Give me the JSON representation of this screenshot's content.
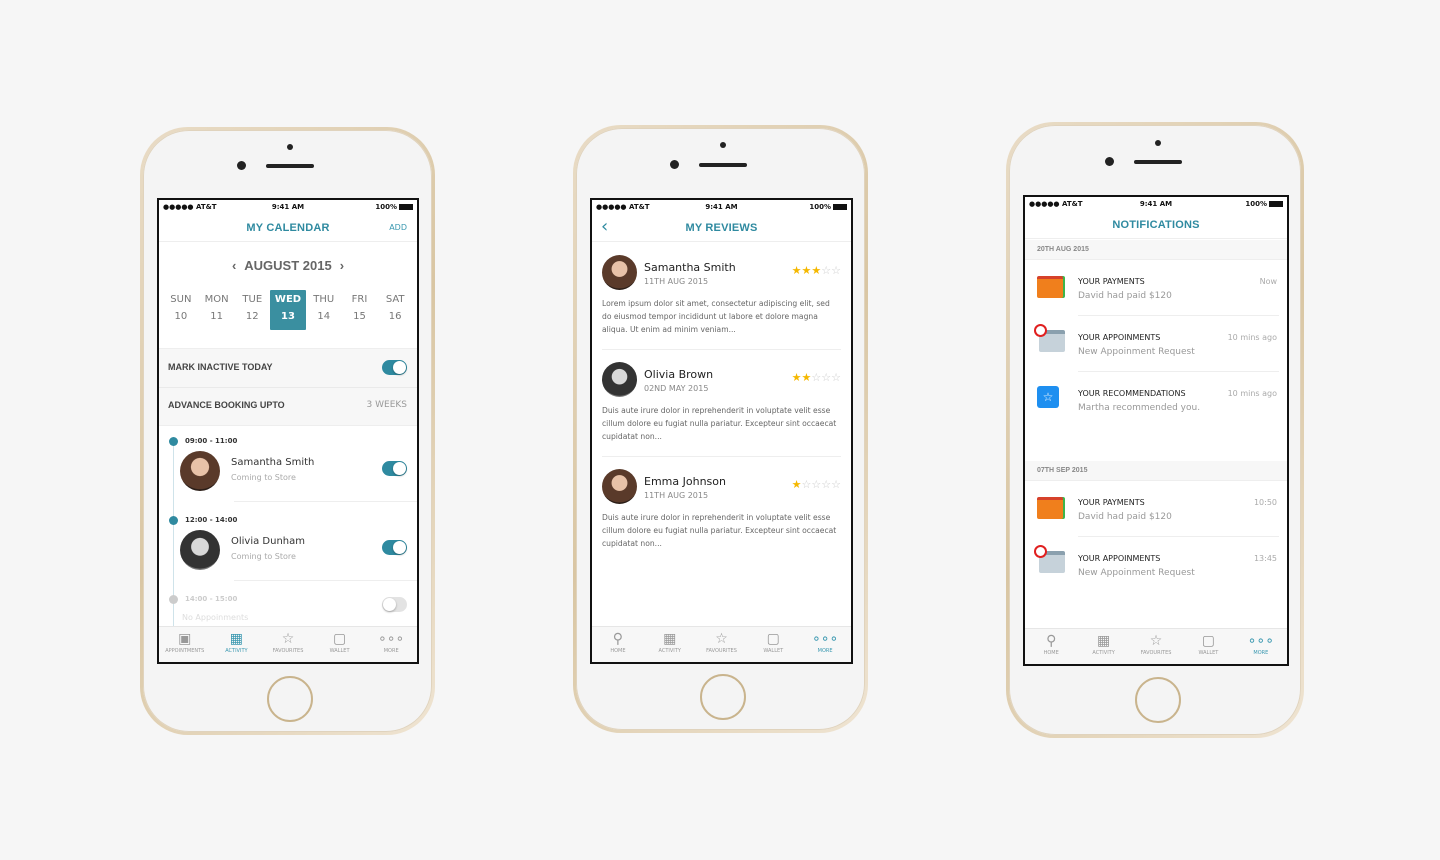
{
  "colors": {
    "accent": "#2f8aa0",
    "star": "#f5b800"
  },
  "status": {
    "carrier": "●●●●● AT&T",
    "time": "9:41 AM",
    "battery": "100%"
  },
  "calendar": {
    "title": "MY CALENDAR",
    "add": "ADD",
    "month": "AUGUST 2015",
    "days": [
      {
        "name": "SUN",
        "num": "10"
      },
      {
        "name": "MON",
        "num": "11"
      },
      {
        "name": "TUE",
        "num": "12"
      },
      {
        "name": "WED",
        "num": "13",
        "selected": true
      },
      {
        "name": "THU",
        "num": "14"
      },
      {
        "name": "FRI",
        "num": "15"
      },
      {
        "name": "SAT",
        "num": "16"
      }
    ],
    "mark_inactive": {
      "label": "MARK INACTIVE TODAY",
      "on": true
    },
    "advance": {
      "label": "ADVANCE BOOKING UPTO",
      "value": "3 WEEKS"
    },
    "slots": [
      {
        "time": "09:00 - 11:00",
        "name": "Samantha Smith",
        "sub": "Coming to Store",
        "on": true
      },
      {
        "time": "12:00 - 14:00",
        "name": "Olivia Dunham",
        "sub": "Coming to Store",
        "on": true
      },
      {
        "time": "14:00 - 15:00",
        "name": "",
        "sub": "No Appoinments",
        "on": false
      }
    ],
    "tabs": [
      {
        "label": "APPOINTMENTS",
        "icon": "contact-book-icon"
      },
      {
        "label": "ACTIVITY",
        "icon": "calendar-icon",
        "active": true
      },
      {
        "label": "FAVOURITES",
        "icon": "star-icon"
      },
      {
        "label": "WALLET",
        "icon": "wallet-icon"
      },
      {
        "label": "MORE",
        "icon": "more-icon"
      }
    ]
  },
  "reviews": {
    "title": "MY REVIEWS",
    "items": [
      {
        "name": "Samantha Smith",
        "date": "11TH AUG 2015",
        "rating": 3,
        "text": "Lorem ipsum dolor sit amet, consectetur adipiscing elit, sed do eiusmod tempor incididunt ut labore et dolore magna aliqua. Ut enim ad minim veniam..."
      },
      {
        "name": "Olivia Brown",
        "date": "02ND MAY 2015",
        "rating": 2,
        "text": "Duis aute irure dolor in reprehenderit in voluptate velit esse cillum dolore eu fugiat nulla pariatur. Excepteur sint occaecat cupidatat non..."
      },
      {
        "name": "Emma Johnson",
        "date": "11TH AUG 2015",
        "rating": 1,
        "text": "Duis aute irure dolor in reprehenderit in voluptate velit esse cillum dolore eu fugiat nulla pariatur. Excepteur sint occaecat cupidatat non..."
      }
    ],
    "tabs": [
      {
        "label": "HOME",
        "icon": "search-icon"
      },
      {
        "label": "ACTIVITY",
        "icon": "calendar-icon"
      },
      {
        "label": "FAVOURITES",
        "icon": "star-icon"
      },
      {
        "label": "WALLET",
        "icon": "wallet-icon"
      },
      {
        "label": "MORE",
        "icon": "more-icon",
        "active": true
      }
    ]
  },
  "notifications": {
    "title": "NOTIFICATIONS",
    "groups": [
      {
        "date": "20TH AUG 2015",
        "items": [
          {
            "type": "wallet",
            "title": "YOUR PAYMENTS",
            "sub": "David had paid $120",
            "time": "Now"
          },
          {
            "type": "appointment",
            "title": "YOUR APPOINMENTS",
            "sub": "New Appoinment Request",
            "time": "10 mins ago"
          },
          {
            "type": "recommendation",
            "title": "YOUR RECOMMENDATIONS",
            "sub": "Martha recommended you.",
            "time": "10 mins ago"
          }
        ]
      },
      {
        "date": "07TH SEP 2015",
        "items": [
          {
            "type": "wallet",
            "title": "YOUR PAYMENTS",
            "sub": "David had paid $120",
            "time": "10:50"
          },
          {
            "type": "appointment",
            "title": "YOUR APPOINMENTS",
            "sub": "New Appoinment Request",
            "time": "13:45"
          }
        ]
      }
    ],
    "tabs": [
      {
        "label": "HOME",
        "icon": "search-icon"
      },
      {
        "label": "ACTIVITY",
        "icon": "calendar-icon"
      },
      {
        "label": "FAVOURITES",
        "icon": "star-icon"
      },
      {
        "label": "WALLET",
        "icon": "wallet-icon"
      },
      {
        "label": "MORE",
        "icon": "more-icon",
        "active": true
      }
    ]
  }
}
